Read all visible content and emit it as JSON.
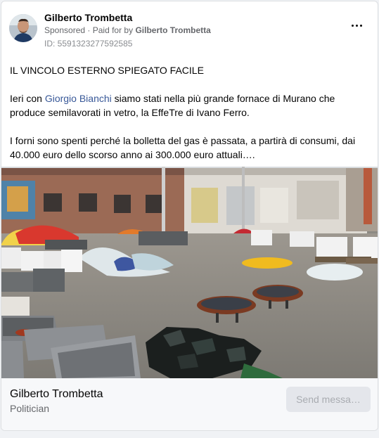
{
  "post": {
    "author": "Gilberto Trombetta",
    "sponsored_label": "Sponsored",
    "paid_for_prefix": "Paid for by",
    "paid_for_name": "Gilberto Trombetta",
    "ad_id": "ID: 5591323277592585",
    "more_icon": "more-horizontal-icon"
  },
  "body": {
    "headline": "IL VINCOLO ESTERNO SPIEGATO FACILE",
    "p2_before": "Ieri con ",
    "p2_link": "Giorgio Bianchi",
    "p2_after": " siamo stati nella più grande fornace di Murano che produce semilavorati in vetro, la EffeTre di Ivano Ferro.",
    "p3": "I forni sono spenti perché la bolletta del gas è passata, a partirà di consumi, dai 40.000 euro dello scorso anno ai 300.000 euro attuali…."
  },
  "footer": {
    "page_name": "Gilberto Trombetta",
    "category": "Politician",
    "button_label": "Send messa…"
  },
  "colors": {
    "link": "#385898",
    "secondary_text": "#65676b",
    "button_bg": "#e4e6eb"
  }
}
